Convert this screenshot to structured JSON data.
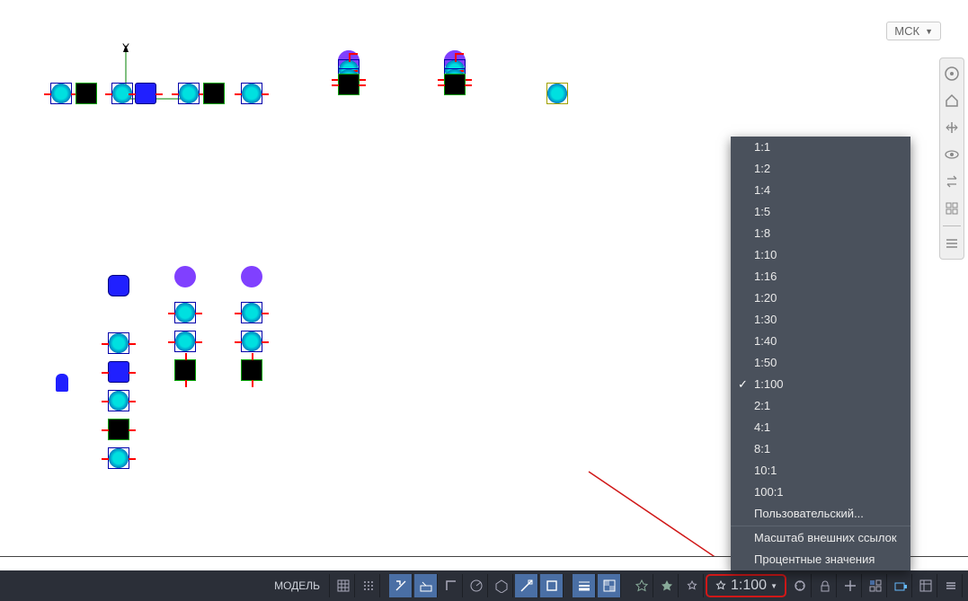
{
  "msk": {
    "label": "МСК"
  },
  "axes": {
    "y_label": "Y"
  },
  "scale_menu": {
    "items": [
      {
        "label": "1:1",
        "checked": false
      },
      {
        "label": "1:2",
        "checked": false
      },
      {
        "label": "1:4",
        "checked": false
      },
      {
        "label": "1:5",
        "checked": false
      },
      {
        "label": "1:8",
        "checked": false
      },
      {
        "label": "1:10",
        "checked": false
      },
      {
        "label": "1:16",
        "checked": false
      },
      {
        "label": "1:20",
        "checked": false
      },
      {
        "label": "1:30",
        "checked": false
      },
      {
        "label": "1:40",
        "checked": false
      },
      {
        "label": "1:50",
        "checked": false
      },
      {
        "label": "1:100",
        "checked": true
      },
      {
        "label": "2:1",
        "checked": false
      },
      {
        "label": "4:1",
        "checked": false
      },
      {
        "label": "8:1",
        "checked": false
      },
      {
        "label": "10:1",
        "checked": false
      },
      {
        "label": "100:1",
        "checked": false
      }
    ],
    "custom": "Пользовательский...",
    "xref": "Масштаб внешних ссылок",
    "percent": "Процентные значения"
  },
  "statusbar": {
    "model": "МОДЕЛЬ",
    "scale_current": "1:100"
  },
  "nav_icons": [
    "compass",
    "home",
    "pan",
    "orbit",
    "swap",
    "views",
    "menu"
  ],
  "status_icons": [
    "grid",
    "snap",
    "infer",
    "dynamic",
    "ortho",
    "polar",
    "iso",
    "otrack",
    "osnap",
    "lineweight",
    "transparency",
    "cycle",
    "annomon",
    "annoauto",
    "annoscale-icon",
    "annoscale",
    "workspace",
    "monitor",
    "units",
    "quickprops",
    "lock",
    "isolate",
    "hardware",
    "cleanscreen",
    "custom"
  ],
  "colors": {
    "status_bg": "#2b2f38",
    "status_active": "#4a6fa5",
    "popup_bg": "#4a515c",
    "highlight": "#d01818"
  }
}
